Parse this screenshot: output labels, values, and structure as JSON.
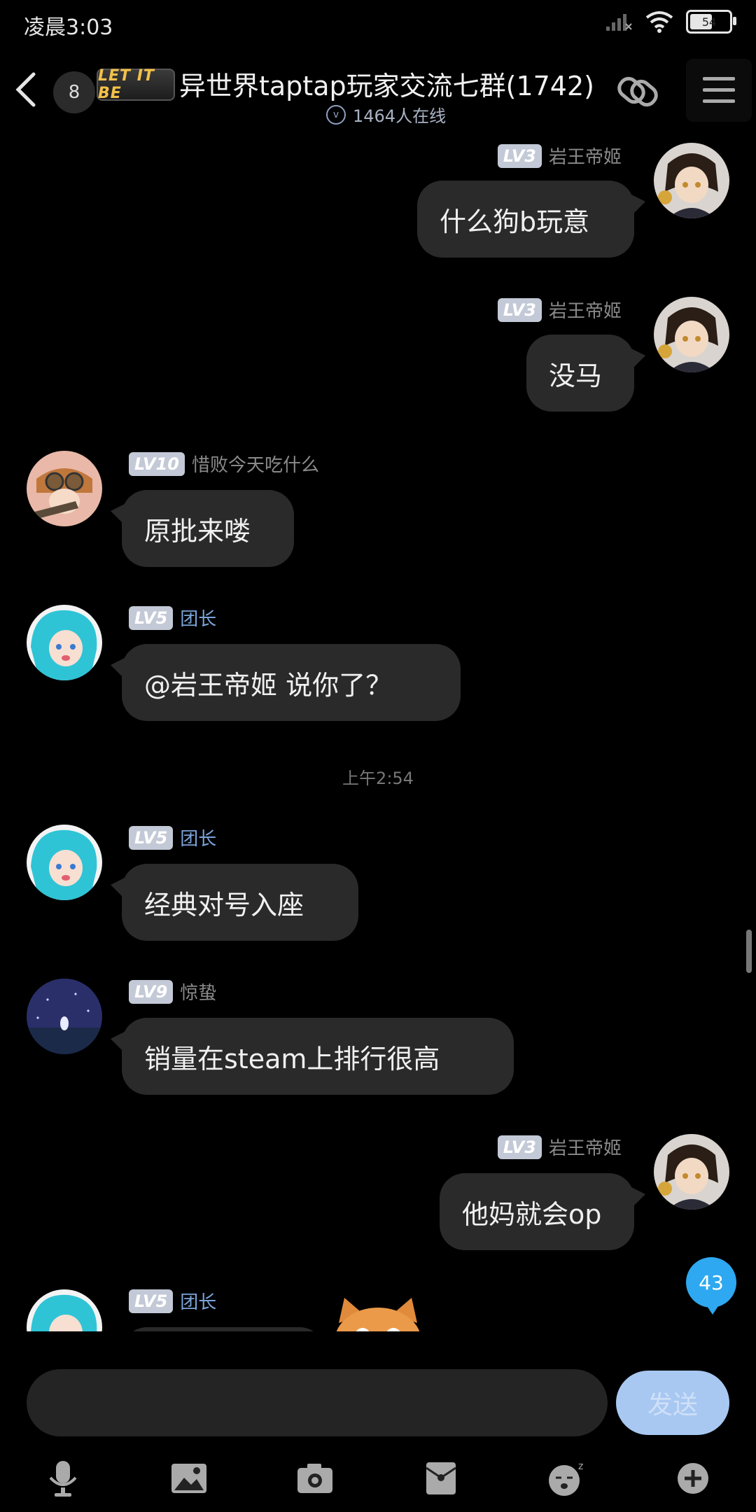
{
  "status": {
    "time": "凌晨3:03",
    "battery": "54"
  },
  "header": {
    "unread": "8",
    "logo_text": "LET IT BE",
    "title": "异世界taptap玩家交流七群(1742)",
    "online": "1464人在线"
  },
  "messages": [
    {
      "side": "right",
      "level": "LV3",
      "nick": "岩王帝姬",
      "text": "什么狗b玩意"
    },
    {
      "side": "right",
      "level": "LV3",
      "nick": "岩王帝姬",
      "text": "没马"
    },
    {
      "side": "left",
      "level": "LV10",
      "nick": "惜败今天吃什么",
      "text": "原批来喽"
    },
    {
      "side": "left",
      "level": "LV5",
      "nick": "团长",
      "text": "@岩王帝姬 说你了？"
    },
    {
      "side": "left",
      "level": "LV5",
      "nick": "团长",
      "text": "经典对号入座"
    },
    {
      "side": "left",
      "level": "LV9",
      "nick": "惊蛰",
      "text": "销量在steam上排行很高"
    },
    {
      "side": "right",
      "level": "LV3",
      "nick": "岩王帝姬",
      "text": "他妈就会op"
    },
    {
      "side": "left",
      "level": "LV5",
      "nick": "团长",
      "text": ""
    }
  ],
  "timestamp": "上午2:54",
  "new_messages": "43",
  "input": {
    "placeholder": "",
    "send_label": "发送"
  },
  "toolbar": [
    "microphone-icon",
    "image-icon",
    "camera-icon",
    "red-packet-icon",
    "emoji-icon",
    "plus-icon"
  ]
}
